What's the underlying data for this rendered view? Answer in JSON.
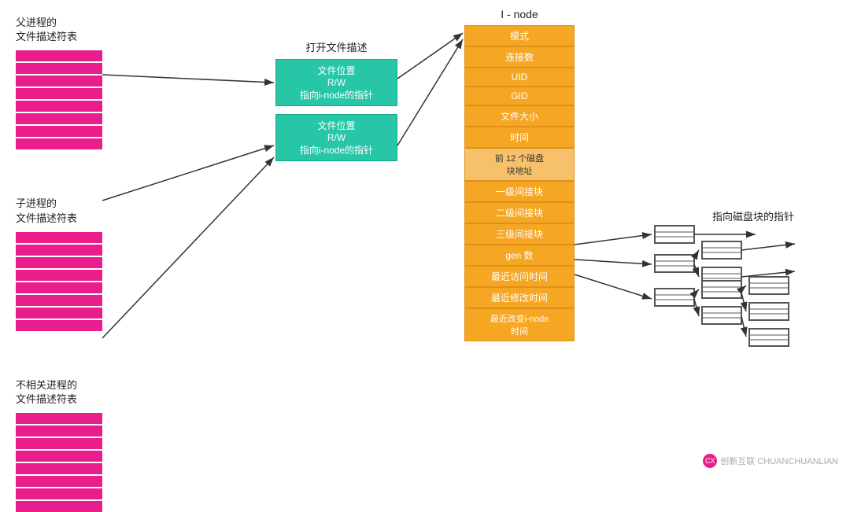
{
  "fd_groups": [
    {
      "id": "parent",
      "label": "父进程的\n文件描述符表",
      "rows": 8
    },
    {
      "id": "child",
      "label": "子进程的\n文件描述符表",
      "rows": 8
    },
    {
      "id": "unrelated",
      "label": "不相关进程的\n文件描述符表",
      "rows": 8
    }
  ],
  "open_file": {
    "label": "打开文件描述",
    "entries": [
      [
        "文件位置",
        "R/W",
        "指向i-node的指针"
      ],
      [
        "文件位置",
        "R/W",
        "指向i-node的指针"
      ]
    ]
  },
  "inode": {
    "label": "I - node",
    "rows": [
      {
        "text": "模式",
        "light": false
      },
      {
        "text": "连接数",
        "light": false
      },
      {
        "text": "UID",
        "light": false
      },
      {
        "text": "GID",
        "light": false
      },
      {
        "text": "文件大小",
        "light": false
      },
      {
        "text": "时间",
        "light": false
      },
      {
        "text": "前 12 个磁盘\n块地址",
        "light": true
      },
      {
        "text": "一级间接块",
        "light": false
      },
      {
        "text": "二级间接块",
        "light": false
      },
      {
        "text": "三级间接块",
        "light": false
      },
      {
        "text": "gen 数",
        "light": false
      },
      {
        "text": "最近访问时间",
        "light": false
      },
      {
        "text": "最近修改时间",
        "light": false
      },
      {
        "text": "最近改变i-node\n时间",
        "light": false
      }
    ]
  },
  "disk_pointer_label": "指向磁盘块的指针",
  "watermark": {
    "icon": "CX",
    "text": "创新互联 CHUANCHUANLIAN"
  }
}
